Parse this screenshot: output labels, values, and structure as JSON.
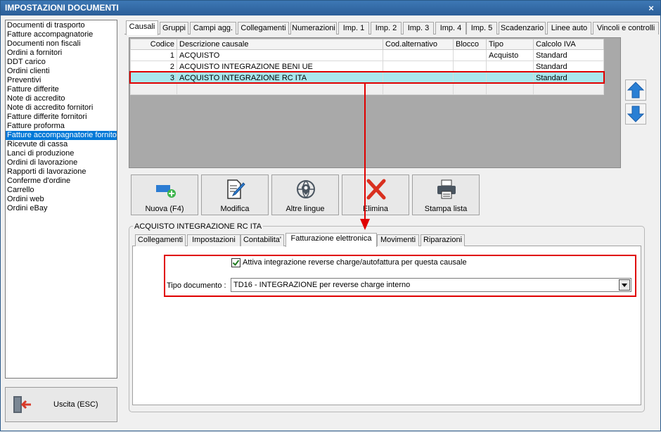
{
  "window": {
    "title": "IMPOSTAZIONI DOCUMENTI",
    "close_glyph": "×"
  },
  "doc_types": [
    "Documenti di trasporto",
    "Fatture accompagnatorie",
    "Documenti non fiscali",
    "Ordini a fornitori",
    "DDT carico",
    "Ordini clienti",
    "Preventivi",
    "Fatture differite",
    "Note di accredito",
    "Note di accredito fornitori",
    "Fatture differite fornitori",
    "Fatture proforma",
    "Fatture accompagnatorie fornito",
    "Ricevute di cassa",
    "Lanci di produzione",
    "Ordini di lavorazione",
    "Rapporti di lavorazione",
    "Conferme d'ordine",
    "Carrello",
    "Ordini web",
    "Ordini eBay"
  ],
  "doc_selected_index": 12,
  "exit_button": {
    "label": "Uscita (ESC)",
    "icon": "exit-door-icon"
  },
  "top_tabs": [
    "Causali",
    "Gruppi",
    "Campi agg.",
    "Collegamenti",
    "Numerazioni",
    "Imp. 1",
    "Imp. 2",
    "Imp. 3",
    "Imp. 4",
    "Imp. 5",
    "Scadenzario",
    "Linee auto",
    "Vincoli e controlli"
  ],
  "top_tab_active": 0,
  "grid": {
    "columns": [
      "Codice",
      "Descrizione causale",
      "Cod.alternativo",
      "Blocco",
      "Tipo",
      "Calcolo IVA"
    ],
    "rows": [
      {
        "codice": "1",
        "descrizione": "ACQUISTO",
        "cod_alt": "",
        "blocco": "",
        "tipo": "Acquisto",
        "calcolo_iva": "Standard"
      },
      {
        "codice": "2",
        "descrizione": "ACQUISTO INTEGRAZIONE BENI UE",
        "cod_alt": "",
        "blocco": "",
        "tipo": "",
        "calcolo_iva": "Standard"
      },
      {
        "codice": "3",
        "descrizione": "ACQUISTO INTEGRAZIONE RC ITA",
        "cod_alt": "",
        "blocco": "",
        "tipo": "",
        "calcolo_iva": "Standard"
      }
    ],
    "selected_row": 2
  },
  "side_buttons": {
    "up_icon": "arrow-up-icon",
    "down_icon": "arrow-down-icon"
  },
  "actions": {
    "nuova": "Nuova (F4)",
    "modifica": "Modifica",
    "altre_lingue": "Altre lingue",
    "elimina": "Elimina",
    "stampa": "Stampa lista"
  },
  "detail": {
    "group_title": "ACQUISTO INTEGRAZIONE RC ITA",
    "tabs": [
      "Collegamenti",
      "Impostazioni",
      "Contabilita'",
      "Fatturazione elettronica",
      "Movimenti",
      "Riparazioni"
    ],
    "active_tab": 3,
    "reverse_charge_checkbox": {
      "label": "Attiva integrazione reverse charge/autofattura per questa causale",
      "checked": true
    },
    "tipo_documento": {
      "label": "Tipo documento :",
      "value": "TD16 - INTEGRAZIONE per reverse charge interno"
    }
  },
  "colors": {
    "highlight_red": "#e00000",
    "selection_blue": "#0078d7",
    "row_selected": "#a9e7ee",
    "title_bar": "#2b5e98"
  }
}
